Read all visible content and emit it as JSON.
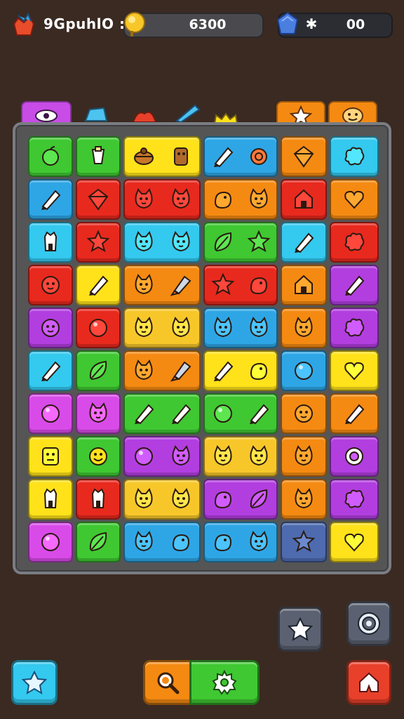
{
  "hud": {
    "player_name": "9GpuhlО :",
    "coin_value": "6300",
    "gem_symbol": "✱",
    "gem_value": "00"
  },
  "colors": {
    "background": "#3a2a22",
    "green": "#3fc832",
    "red": "#e8291e",
    "blue": "#2ea6e6",
    "orange": "#f58a12",
    "yellow": "#ffe21a",
    "purple": "#b23ee0",
    "cyan": "#34c9ef",
    "magenta": "#d84be8",
    "amber": "#f7c72a",
    "slate": "#4e6bb0"
  },
  "above_board": [
    {
      "name": "eye-icon",
      "color": "#c84ce6"
    },
    {
      "name": "crystal-icon",
      "color": "#4dc3ef"
    },
    {
      "name": "critter-icon",
      "color": "#e8402a"
    },
    {
      "name": "pencil-icon",
      "color": "#4dc3ef"
    },
    {
      "name": "crown-icon",
      "color": "#ffe21a"
    },
    {
      "name": "star-icon",
      "color": "#f58a12"
    },
    {
      "name": "smiley-icon",
      "color": "#f58a12"
    }
  ],
  "board": {
    "rows": [
      [
        "green:apple-icon",
        "green:cup-icon",
        "yellow:chest-icon|wood-icon",
        "blue:pencil-icon|shell-icon",
        "orange:gem-icon",
        "cyan:splat-icon"
      ],
      [
        "blue:pencil-icon",
        "red:gem-icon",
        "red:cat-icon|cat-icon",
        "orange:bird-icon|cat-icon",
        "red:house-icon",
        "orange:heart-icon"
      ],
      [
        "cyan:tower-icon",
        "red:star-icon",
        "cyan:cat-icon|cat-icon",
        "green:leaf-icon|star-icon",
        "cyan:pencil-icon",
        "red:splat-icon"
      ],
      [
        "red:face-icon",
        "yellow:pencil-icon",
        "orange:cat-icon|rocket-icon",
        "red:star-icon|bird-icon",
        "orange:house-icon",
        "purple:pencil-icon"
      ],
      [
        "purple:face-icon",
        "red:orb-icon",
        "amber:cat-icon|cat-icon",
        "blue:cat-icon|cat-icon",
        "orange:cat-icon",
        "purple:splat-icon"
      ],
      [
        "cyan:pencil-icon",
        "green:leaf-icon",
        "orange:cat-icon|rocket-icon",
        "yellow:pencil-icon|bird-icon",
        "blue:orb-icon",
        "yellow:heart-icon"
      ],
      [
        "magenta:orb-icon",
        "magenta:cat-icon",
        "green:pencil-icon|pencil-icon",
        "green:orb-icon|pencil-icon",
        "orange:face-icon",
        "orange:pencil-icon"
      ],
      [
        "yellow:monster-icon",
        "green:smiley-icon",
        "purple:orb-icon|cat-icon",
        "amber:cat-icon|cat-icon",
        "orange:cat-icon",
        "purple:ring-icon"
      ],
      [
        "yellow:tower-icon",
        "red:tower-icon",
        "amber:cat-icon|cat-icon",
        "purple:bird-icon|leaf-icon",
        "orange:cat-icon",
        "purple:splat-icon"
      ],
      [
        "magenta:orb-icon",
        "green:leaf-icon",
        "blue:cat-icon|bird-icon",
        "blue:bird-icon|cat-icon",
        "slate:star-icon",
        "yellow:heart-icon"
      ]
    ]
  },
  "buttons": {
    "star_top": {
      "name": "star-button",
      "color": "#5b6170"
    },
    "settings": {
      "name": "settings-button",
      "color": "#5b6170"
    },
    "star_bottom": {
      "name": "star-bottom-button",
      "color": "#34c9ef"
    },
    "search": {
      "name": "search-button",
      "color": "#f58a12"
    },
    "gear": {
      "name": "gear-button",
      "color": "#3fc832"
    },
    "home": {
      "name": "home-button",
      "color": "#e8402a"
    }
  }
}
